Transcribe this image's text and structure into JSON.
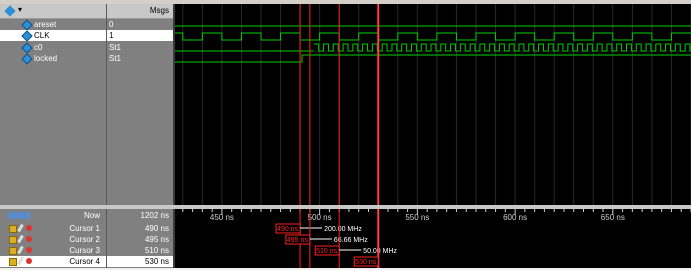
{
  "header": {
    "msgs_label": "Msgs"
  },
  "signals": [
    {
      "name": "areset",
      "value": "0"
    },
    {
      "name": "CLK",
      "value": "1"
    },
    {
      "name": "c0",
      "value": "St1"
    },
    {
      "name": "locked",
      "value": "St1"
    }
  ],
  "timeline": {
    "now_label": "Now",
    "now_value": "1202 ns",
    "ticks": [
      "450 ns",
      "500 ns",
      "550 ns",
      "600 ns",
      "650 ns"
    ],
    "tick_values_ns": [
      450,
      500,
      550,
      600,
      650
    ],
    "view_start_ns": 426,
    "view_end_ns": 690
  },
  "cursors": [
    {
      "name": "Cursor 1",
      "value": "490 ns",
      "time_ns": 490,
      "delta_label": "200.00 MHz"
    },
    {
      "name": "Cursor 2",
      "value": "495 ns",
      "time_ns": 495,
      "delta_label": "66.66 MHz"
    },
    {
      "name": "Cursor 3",
      "value": "510 ns",
      "time_ns": 510,
      "delta_label": "50.00 MHz"
    },
    {
      "name": "Cursor 4",
      "value": "530 ns",
      "time_ns": 530,
      "delta_label": ""
    }
  ],
  "colors": {
    "wave": "#00d000",
    "cursor": "#ff2020",
    "active_cursor": "#ff4040",
    "grid": "#2a2a2a"
  }
}
